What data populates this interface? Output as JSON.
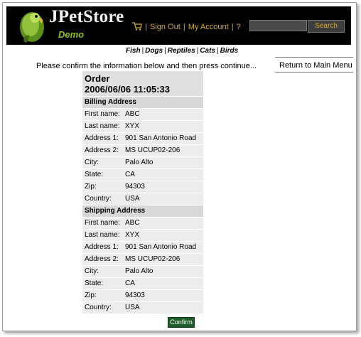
{
  "header": {
    "logo_title": "JPetStore",
    "logo_subtitle": "Demo",
    "menu": {
      "sign_out": "Sign Out",
      "my_account": "My Account",
      "help": "?",
      "separator": "|"
    },
    "search": {
      "value": "",
      "button_label": "Search"
    }
  },
  "quicklinks": [
    "Fish",
    "Dogs",
    "Reptiles",
    "Cats",
    "Birds"
  ],
  "message": "Please confirm the information below and then press continue...",
  "return_link": "Return to Main Menu",
  "order": {
    "title": "Order",
    "date": "2006/06/06 11:05:33",
    "billing": {
      "heading": "Billing Address",
      "rows": [
        {
          "label": "First name:",
          "value": "ABC"
        },
        {
          "label": "Last name:",
          "value": "XYX"
        },
        {
          "label": "Address 1:",
          "value": "901 San Antonio Road"
        },
        {
          "label": "Address 2:",
          "value": "MS UCUP02-206"
        },
        {
          "label": "City:",
          "value": "Palo Alto"
        },
        {
          "label": "State:",
          "value": "CA"
        },
        {
          "label": "Zip:",
          "value": "94303"
        },
        {
          "label": "Country:",
          "value": "USA"
        }
      ]
    },
    "shipping": {
      "heading": "Shipping Address",
      "rows": [
        {
          "label": "First name:",
          "value": "ABC"
        },
        {
          "label": "Last name:",
          "value": "XYX"
        },
        {
          "label": "Address 1:",
          "value": "901 San Antonio Road"
        },
        {
          "label": "Address 2:",
          "value": "MS UCUP02-206"
        },
        {
          "label": "City:",
          "value": "Palo Alto"
        },
        {
          "label": "State:",
          "value": "CA"
        },
        {
          "label": "Zip:",
          "value": "94303"
        },
        {
          "label": "Country:",
          "value": "USA"
        }
      ]
    }
  },
  "confirm_button": "Confirm",
  "colors": {
    "header_bg": "#000000",
    "menu_gold": "#d4aa2d",
    "demo_green": "#8fbf1c",
    "confirm_green": "#1f5e2a"
  }
}
